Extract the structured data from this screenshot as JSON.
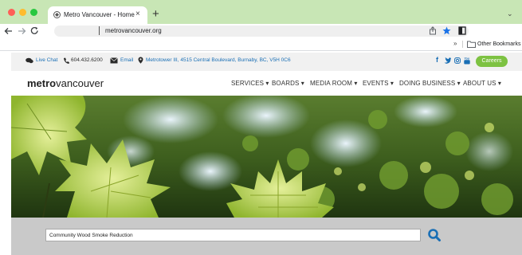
{
  "browser": {
    "tab_title": "Metro Vancouver - Home",
    "tab_close": "×",
    "new_tab": "+",
    "tab_menu": "⌄",
    "url": "metrovancouver.org",
    "bookmarks_overflow": "»",
    "other_bookmarks": "Other Bookmarks",
    "colors": {
      "close": "#ff5f57",
      "minimize": "#febc2e",
      "maximize": "#28c840",
      "accent_star": "#1a73e8"
    }
  },
  "contact": {
    "live_chat": "Live Chat",
    "phone": "604.432.6200",
    "email": "Email",
    "address": "Metrotower III, 4515 Central Boulevard, Burnaby, BC, V5H 0C6",
    "social": [
      "f",
      "y",
      "ig",
      "yt"
    ],
    "careers": "Careers"
  },
  "header": {
    "logo_bold": "metro",
    "logo_light": "vancouver",
    "nav": [
      "SERVICES ▾",
      "BOARDS ▾",
      "MEDIA ROOM ▾",
      "EVENTS ▾",
      "DOING BUSINESS ▾",
      "ABOUT US ▾"
    ]
  },
  "search": {
    "value": "Community Wood Smoke Reduction"
  }
}
